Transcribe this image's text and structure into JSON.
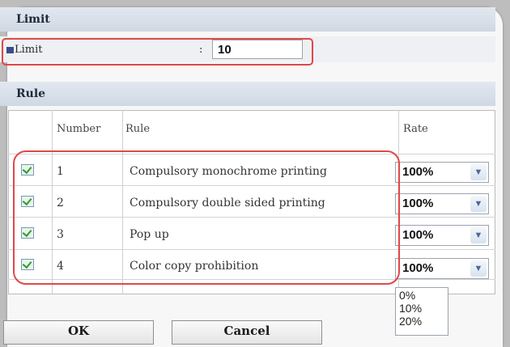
{
  "limit_section": {
    "title": "Limit",
    "label": "Limit",
    "colon": ":",
    "value": "10"
  },
  "rule_section": {
    "title": "Rule"
  },
  "table": {
    "headers": {
      "check": "",
      "number": "Number",
      "rule": "Rule",
      "rate": "Rate"
    },
    "rows": [
      {
        "checked": true,
        "number": "1",
        "rule": "Compulsory monochrome printing",
        "rate": "100%"
      },
      {
        "checked": true,
        "number": "2",
        "rule": "Compulsory double sided printing",
        "rate": "100%"
      },
      {
        "checked": true,
        "number": "3",
        "rule": "Pop up",
        "rate": "100%"
      },
      {
        "checked": true,
        "number": "4",
        "rule": "Color copy prohibition",
        "rate": "100%"
      }
    ]
  },
  "dropdown": {
    "options": [
      "0%",
      "10%",
      "20%"
    ]
  },
  "buttons": {
    "ok": "OK",
    "cancel": "Cancel"
  },
  "colors": {
    "highlight": "#e04848",
    "header_bg": "#d5dde7",
    "check_green": "#2f9a3a"
  }
}
